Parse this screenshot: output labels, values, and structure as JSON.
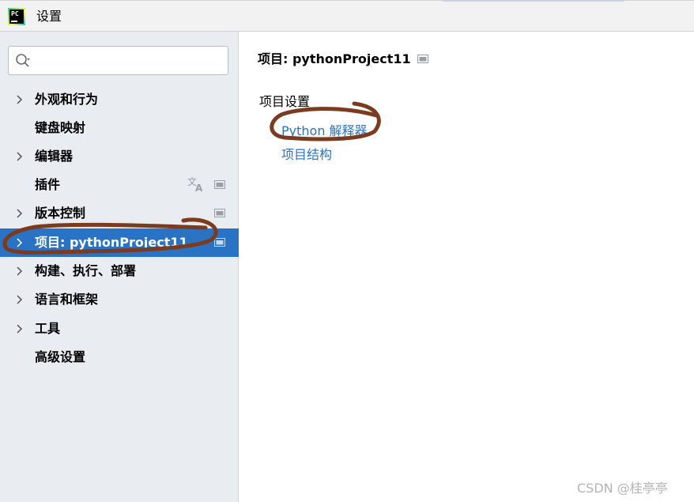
{
  "window": {
    "title": "设置",
    "app_icon": "pycharm-icon",
    "app_icon_text": "PC"
  },
  "sidebar": {
    "search": {
      "value": "",
      "placeholder": "",
      "icon": "search-icon"
    },
    "items": [
      {
        "label": "外观和行为",
        "expandable": true
      },
      {
        "label": "键盘映射",
        "expandable": false
      },
      {
        "label": "编辑器",
        "expandable": true
      },
      {
        "label": "插件",
        "expandable": false,
        "icons": [
          "translate-icon",
          "project-scope-icon"
        ]
      },
      {
        "label": "版本控制",
        "expandable": true,
        "icons": [
          "project-scope-icon"
        ]
      },
      {
        "label": "项目: pythonProject11",
        "expandable": true,
        "selected": true,
        "icons": [
          "project-scope-icon"
        ]
      },
      {
        "label": "构建、执行、部署",
        "expandable": true
      },
      {
        "label": "语言和框架",
        "expandable": true
      },
      {
        "label": "工具",
        "expandable": true
      },
      {
        "label": "高级设置",
        "expandable": false
      }
    ]
  },
  "content": {
    "title": "项目: pythonProject11",
    "section_heading": "项目设置",
    "links": [
      {
        "label": "Python 解释器"
      },
      {
        "label": "项目结构"
      }
    ]
  },
  "watermark": "CSDN @桂亭亭",
  "colors": {
    "sidebar_bg": "#e9ecf0",
    "selection": "#2a73c4",
    "link": "#2a73c4",
    "annotation": "#7a3b1e"
  }
}
